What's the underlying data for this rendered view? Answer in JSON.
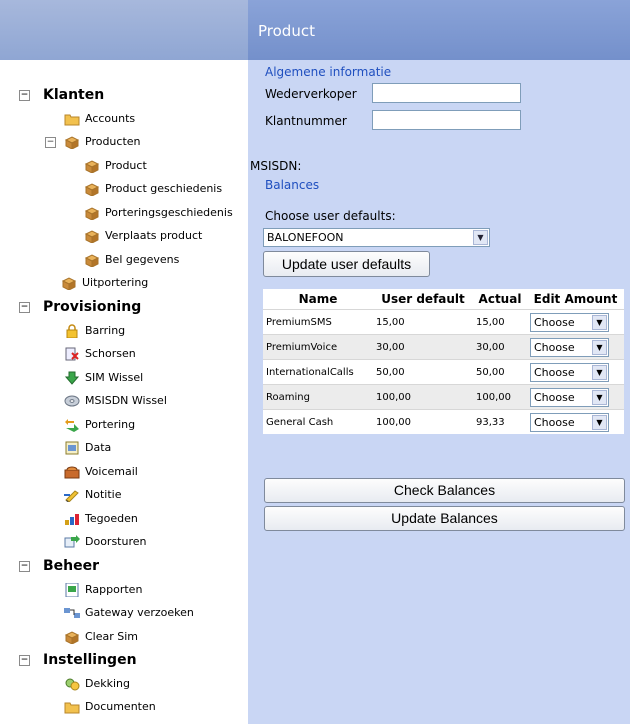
{
  "header": {
    "title": "Product"
  },
  "tree": [
    {
      "type": "section",
      "label": "Klanten",
      "expander": "⊟"
    },
    {
      "type": "item",
      "label": "Accounts",
      "icon": "folder-icon"
    },
    {
      "type": "item",
      "label": "Producten",
      "icon": "box-icon",
      "expander": "⊟"
    },
    {
      "type": "item",
      "label": "Product",
      "icon": "box-icon"
    },
    {
      "type": "item",
      "label": "Product geschiedenis",
      "icon": "box-icon"
    },
    {
      "type": "item",
      "label": "Porteringsgeschiedenis",
      "icon": "box-icon"
    },
    {
      "type": "item",
      "label": "Verplaats product",
      "icon": "box-icon"
    },
    {
      "type": "item",
      "label": "Bel gegevens",
      "icon": "box-icon"
    },
    {
      "type": "item",
      "label": "Uitportering",
      "icon": "box-icon"
    },
    {
      "type": "section",
      "label": "Provisioning",
      "expander": "⊟"
    },
    {
      "type": "item",
      "label": "Barring",
      "icon": "lock-icon"
    },
    {
      "type": "item",
      "label": "Schorsen",
      "icon": "suspend-icon"
    },
    {
      "type": "item",
      "label": "SIM Wissel",
      "icon": "sim-icon"
    },
    {
      "type": "item",
      "label": "MSISDN Wissel",
      "icon": "disc-icon"
    },
    {
      "type": "item",
      "label": "Portering",
      "icon": "transfer-icon"
    },
    {
      "type": "item",
      "label": "Data",
      "icon": "data-icon"
    },
    {
      "type": "item",
      "label": "Voicemail",
      "icon": "voicemail-icon"
    },
    {
      "type": "item",
      "label": "Notitie",
      "icon": "note-icon"
    },
    {
      "type": "item",
      "label": "Tegoeden",
      "icon": "balance-icon"
    },
    {
      "type": "item",
      "label": "Doorsturen",
      "icon": "forward-icon"
    },
    {
      "type": "section",
      "label": "Beheer",
      "expander": "⊟"
    },
    {
      "type": "item",
      "label": "Rapporten",
      "icon": "report-icon"
    },
    {
      "type": "item",
      "label": "Gateway verzoeken",
      "icon": "gateway-icon"
    },
    {
      "type": "item",
      "label": "Clear Sim",
      "icon": "box-icon"
    },
    {
      "type": "section",
      "label": "Instellingen",
      "expander": "⊟"
    },
    {
      "type": "item",
      "label": "Dekking",
      "icon": "coverage-icon"
    },
    {
      "type": "item",
      "label": "Documenten",
      "icon": "folder-icon"
    }
  ],
  "general": {
    "title": "Algemene informatie",
    "reseller_label": "Wederverkoper",
    "reseller_value": "",
    "customer_label": "Klantnummer",
    "customer_value": ""
  },
  "msisdn_label": "MSISDN:",
  "balances_title": "Balances",
  "defaults": {
    "label": "Choose user defaults:",
    "selected": "BALONEFOON",
    "update_button": "Update user defaults"
  },
  "table": {
    "headers": [
      "Name",
      "User default",
      "Actual",
      "Edit Amount"
    ],
    "rows": [
      {
        "name": "PremiumSMS",
        "default": "15,00",
        "actual": "15,00",
        "edit": "Choose"
      },
      {
        "name": "PremiumVoice",
        "default": "30,00",
        "actual": "30,00",
        "edit": "Choose"
      },
      {
        "name": "InternationalCalls",
        "default": "50,00",
        "actual": "50,00",
        "edit": "Choose"
      },
      {
        "name": "Roaming",
        "default": "100,00",
        "actual": "100,00",
        "edit": "Choose"
      },
      {
        "name": "General Cash",
        "default": "100,00",
        "actual": "93,33",
        "edit": "Choose"
      }
    ]
  },
  "buttons": {
    "check": "Check Balances",
    "update": "Update Balances"
  }
}
